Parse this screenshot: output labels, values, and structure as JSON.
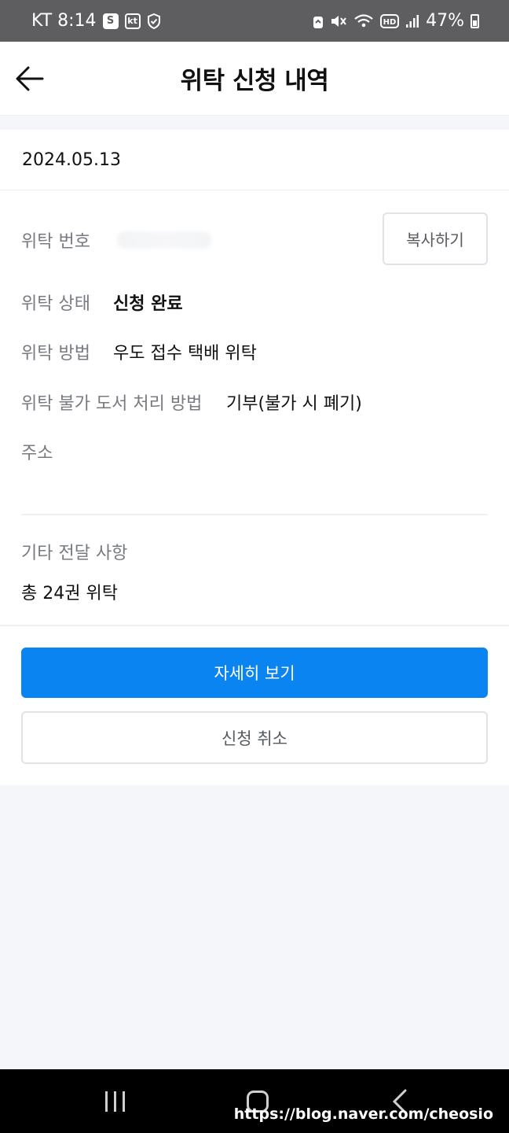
{
  "status_bar": {
    "carrier_time": "KT 8:14",
    "icon_s": "S",
    "icon_kt": "kt",
    "battery_percent": "47%",
    "icons": [
      "samsung-s-icon",
      "kt-icon",
      "shield-icon",
      "lock-icon",
      "mute-icon",
      "wifi-icon",
      "hd-icon",
      "signal-icon",
      "battery-icon"
    ]
  },
  "header": {
    "title": "위탁 신청 내역",
    "back_icon": "arrow-left-icon"
  },
  "request": {
    "date": "2024.05.13",
    "number_label": "위탁 번호",
    "copy_button": "복사하기",
    "status_label": "위탁 상태",
    "status_value": "신청 완료",
    "method_label": "위탁 방법",
    "method_value": "우도 접수 택배 위탁",
    "unavailable_label": "위탁 불가 도서 처리 방법",
    "unavailable_value": "기부(불가 시 폐기)",
    "address_label": "주소",
    "note_label": "기타 전달 사항",
    "note_value": "총 24권 위탁"
  },
  "actions": {
    "detail_button": "자세히 보기",
    "cancel_button": "신청 취소"
  },
  "colors": {
    "primary": "#0a84f0",
    "background": "#f4f6fa",
    "label_gray": "#777b80"
  },
  "nav_bar": {
    "watermark": "https://blog.naver.com/cheosio",
    "icons": [
      "recent-apps-icon",
      "home-icon",
      "back-icon"
    ]
  }
}
